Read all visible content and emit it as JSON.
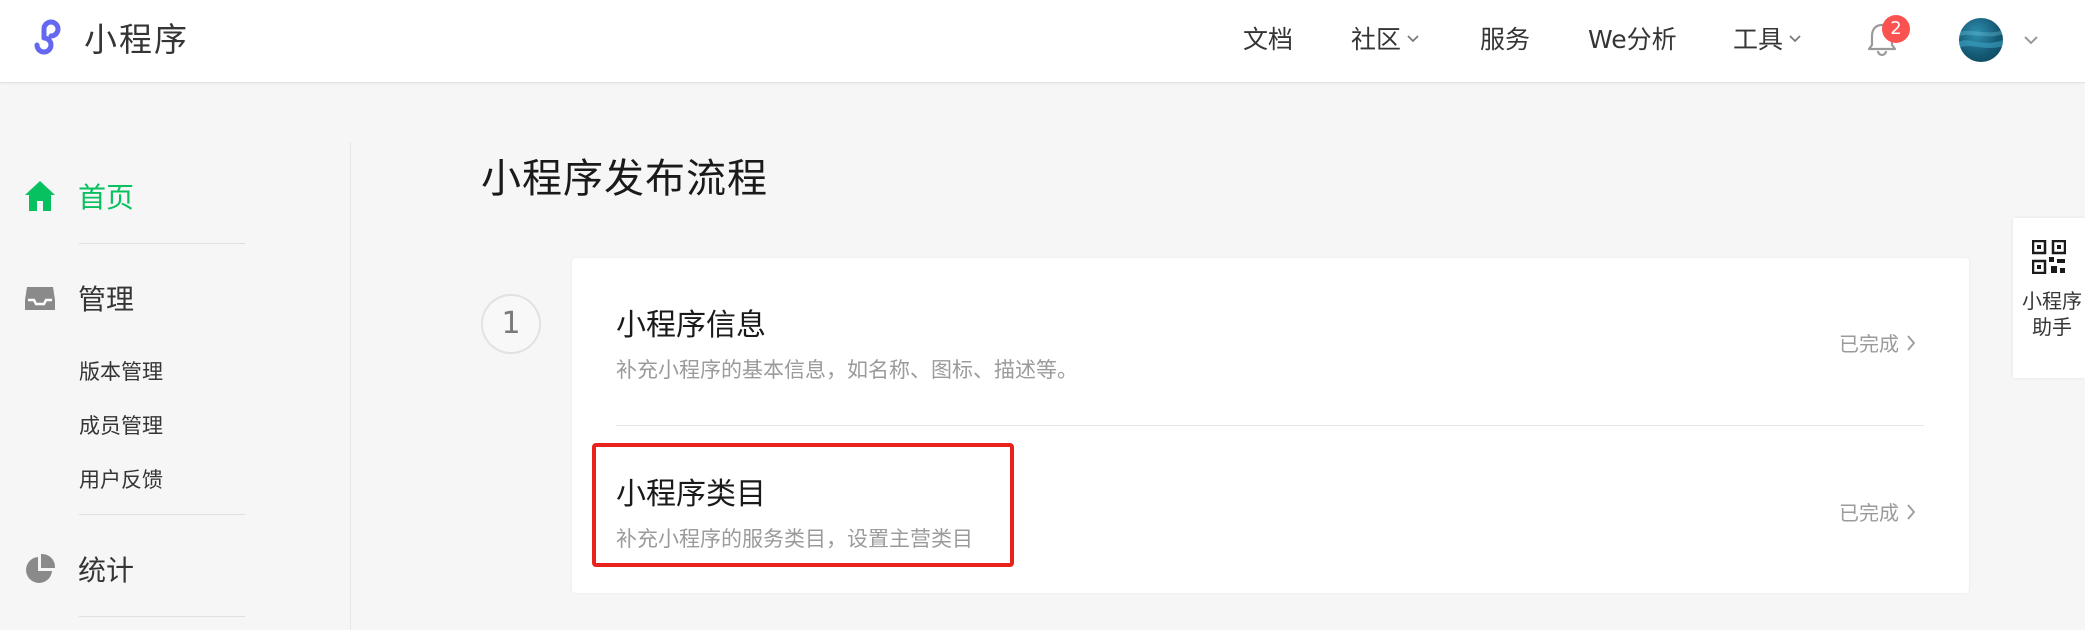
{
  "header": {
    "app_name": "小程序",
    "nav": [
      {
        "label": "文档",
        "has_dropdown": false
      },
      {
        "label": "社区",
        "has_dropdown": true
      },
      {
        "label": "服务",
        "has_dropdown": false
      },
      {
        "label": "We分析",
        "has_dropdown": false
      },
      {
        "label": "工具",
        "has_dropdown": true
      }
    ],
    "notification_count": "2",
    "logo_color": "#6467f0",
    "badge_color": "#fa5151"
  },
  "sidebar": {
    "home": {
      "label": "首页",
      "icon": "home-icon",
      "active": true
    },
    "manage": {
      "label": "管理",
      "icon": "inbox-icon"
    },
    "manage_items": [
      "版本管理",
      "成员管理",
      "用户反馈"
    ],
    "stats": {
      "label": "统计",
      "icon": "pie-chart-icon"
    },
    "active_color": "#07c160"
  },
  "main": {
    "title": "小程序发布流程",
    "step_number": "1",
    "rows": [
      {
        "title": "小程序信息",
        "desc": "补充小程序的基本信息，如名称、图标、描述等。",
        "status": "已完成"
      },
      {
        "title": "小程序类目",
        "desc": "补充小程序的服务类目，设置主营类目",
        "status": "已完成"
      }
    ],
    "highlight_color": "#e8231b"
  },
  "helper": {
    "label": "小程序助手",
    "icon": "qr-code-icon"
  }
}
